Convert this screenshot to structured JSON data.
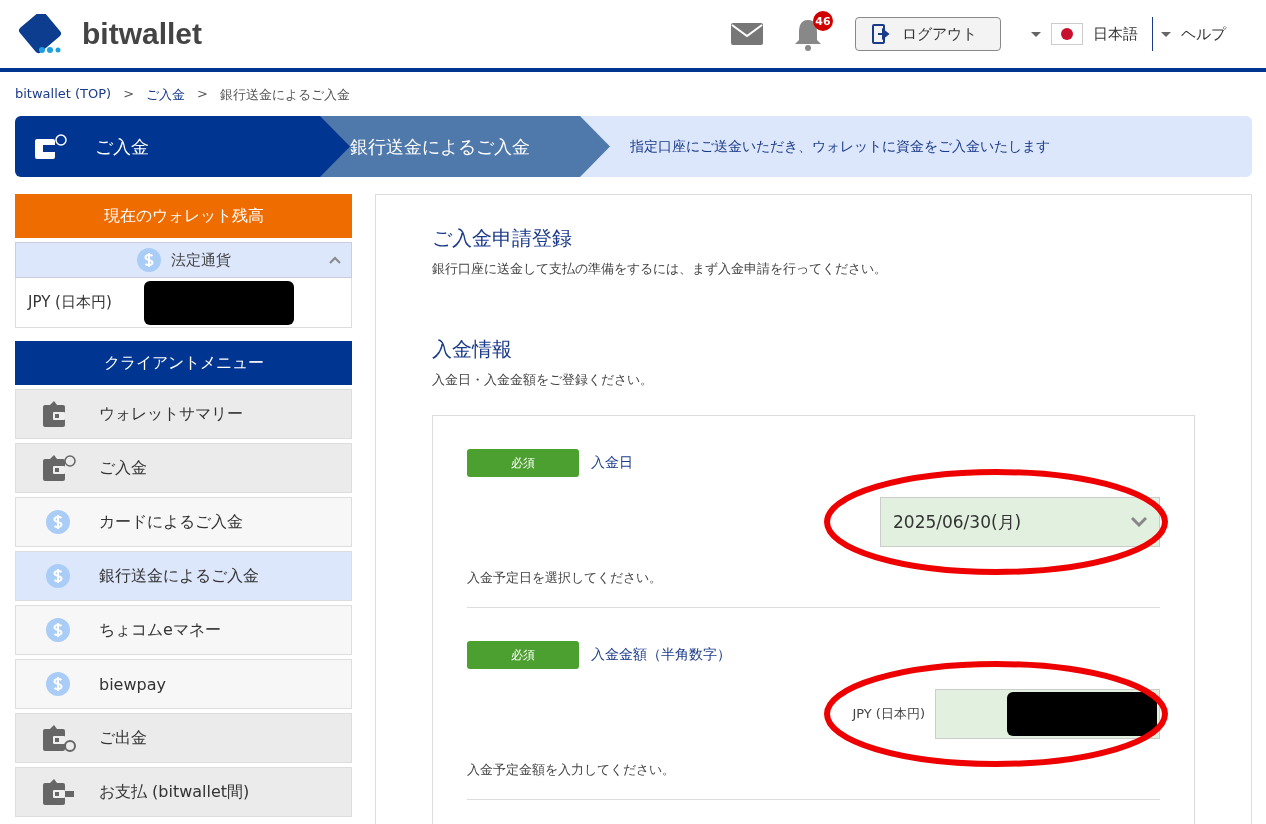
{
  "header": {
    "logo_text": "bitwallet",
    "notification_count": "46",
    "logout_label": "ログアウト",
    "language": "日本語",
    "help": "ヘルプ"
  },
  "breadcrumb": [
    {
      "label": "bitwallet (TOP)",
      "link": true
    },
    {
      "label": ">",
      "link": false
    },
    {
      "label": "ご入金",
      "link": true
    },
    {
      "label": ">",
      "link": false
    },
    {
      "label": "銀行送金によるご入金",
      "link": false
    }
  ],
  "steps": [
    {
      "label": "ご入金",
      "kind": "current"
    },
    {
      "label": "銀行送金によるご入金",
      "kind": "sub"
    }
  ],
  "step_description": "指定口座にご送金いただき、ウォレットに資金をご入金いたします",
  "sidebar": {
    "balance_title": "現在のウォレット残高",
    "currency_group": {
      "label": "法定通貨",
      "expanded": true
    },
    "balances": [
      {
        "currency": "JPY (日本円)",
        "redacted": true
      }
    ],
    "menu_title": "クライアントメニュー",
    "menu": [
      {
        "label": "ウォレットサマリー",
        "kind": "wallet",
        "selected": false
      },
      {
        "label": "ご入金",
        "kind": "deposit",
        "selected": false
      },
      {
        "label": "カードによるご入金",
        "kind": "sub",
        "selected": false
      },
      {
        "label": "銀行送金によるご入金",
        "kind": "sub",
        "selected": true
      },
      {
        "label": "ちょコムeマネー",
        "kind": "sub",
        "selected": false
      },
      {
        "label": "biewpay",
        "kind": "sub",
        "selected": false
      },
      {
        "label": "ご出金",
        "kind": "withdraw",
        "selected": false
      },
      {
        "label": "お支払 (bitwallet間)",
        "kind": "payment",
        "selected": false
      }
    ]
  },
  "main": {
    "title": "ご入金申請登録",
    "subtitle": "銀行口座に送金して支払の準備をするには、まず入金申請を行ってください。",
    "section_title": "入金情報",
    "section_subtitle": "入金日・入金金額をご登録ください。",
    "fields": [
      {
        "kind": "select",
        "required": "必須",
        "label": "入金日",
        "value": "2025/06/30(月)",
        "hint": "入金予定日を選択してください。",
        "circled": true
      },
      {
        "kind": "amount",
        "required": "必須",
        "label": "入金金額（半角数字）",
        "prefix": "JPY (日本円)",
        "redacted": true,
        "hint": "入金予定金額を入力してください。",
        "circled": true
      }
    ]
  }
}
